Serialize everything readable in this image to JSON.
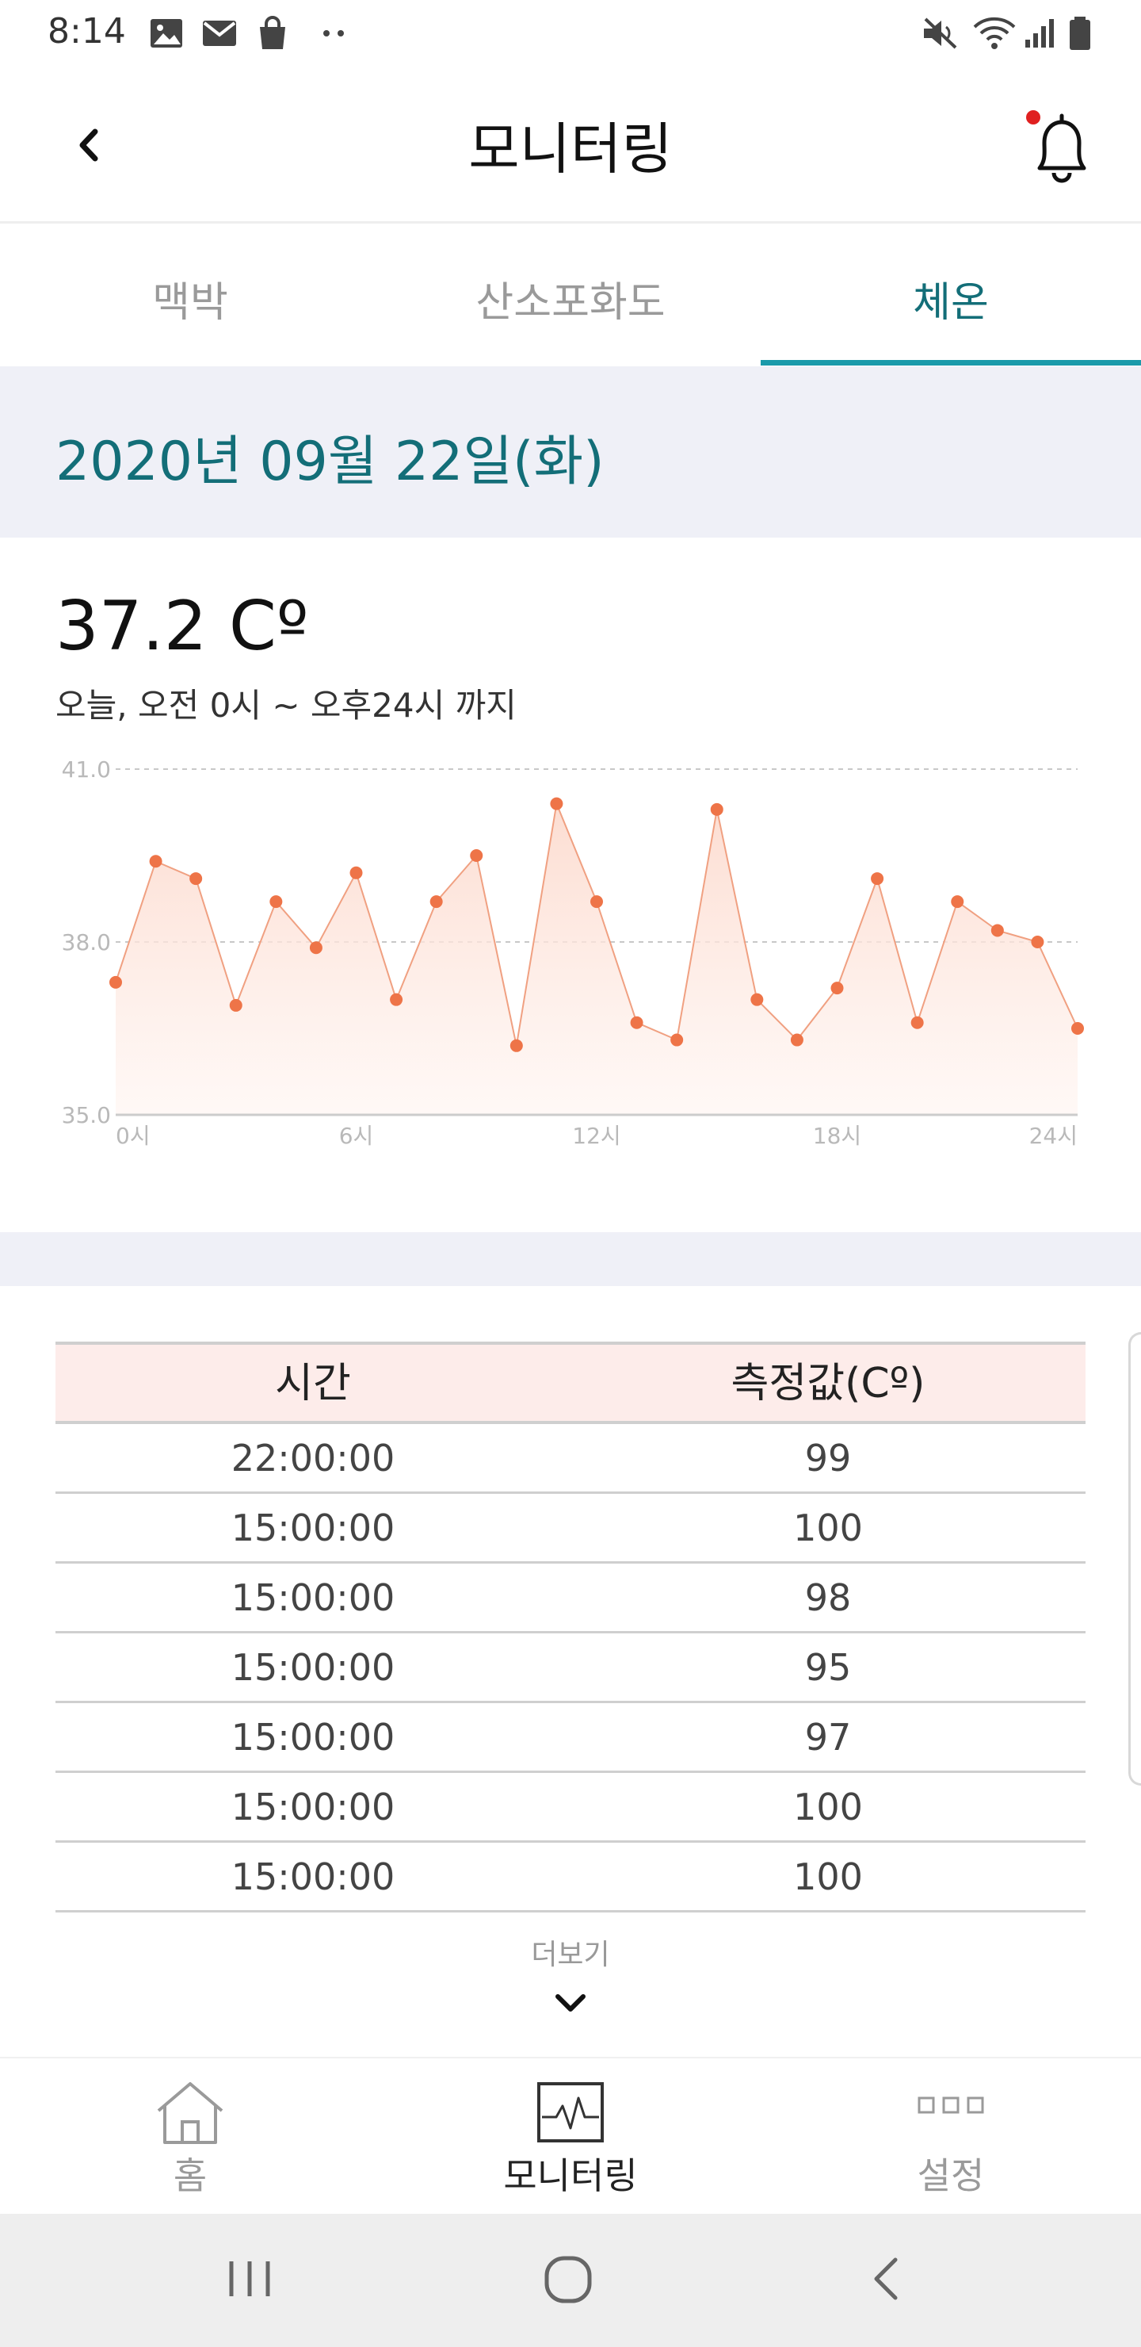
{
  "status_bar": {
    "time": "8:14",
    "left_icons": [
      "image-icon",
      "mail-icon",
      "shopping-bag-icon",
      "more-dots-icon"
    ],
    "right_icons": [
      "mute-icon",
      "wifi-icon",
      "signal-icon",
      "battery-icon"
    ]
  },
  "header": {
    "title": "모니터링",
    "back_icon": "chevron-left-icon",
    "bell_icon": "bell-icon",
    "notification_dot_color": "#e02020"
  },
  "tabs": [
    {
      "label": "맥박",
      "active": false
    },
    {
      "label": "산소포화도",
      "active": false
    },
    {
      "label": "체온",
      "active": true
    }
  ],
  "date_label": "2020년 09월 22일(화)",
  "summary": {
    "current_value": "37.2 Cº",
    "range_text": "오늘, 오전 0시 ~ 오후24시 까지"
  },
  "chart_data": {
    "type": "area",
    "x": [
      0,
      1,
      2,
      3,
      4,
      5,
      6,
      7,
      8,
      9,
      10,
      11,
      12,
      13,
      14,
      15,
      16,
      17,
      18,
      19,
      20,
      21,
      22,
      23,
      24
    ],
    "values": [
      37.3,
      39.4,
      39.1,
      36.9,
      38.7,
      37.9,
      39.2,
      37.0,
      38.7,
      39.5,
      36.2,
      40.4,
      38.7,
      36.6,
      36.3,
      40.3,
      37.0,
      36.3,
      37.2,
      39.1,
      36.6,
      38.7,
      38.2,
      38.0,
      36.5
    ],
    "xticks": [
      "0시",
      "6시",
      "12시",
      "18시",
      "24시"
    ],
    "xtick_values": [
      0,
      6,
      12,
      18,
      24
    ],
    "yticks": [
      "35.0",
      "38.0",
      "41.0"
    ],
    "ytick_values": [
      35.0,
      38.0,
      41.0
    ],
    "ylim": [
      35.0,
      41.0
    ],
    "xlim": [
      0,
      24
    ],
    "line_color": "#f0a081",
    "point_color": "#ee7448",
    "fill_color": "#fde6de",
    "grid": true
  },
  "table": {
    "headers": [
      "시간",
      "측정값(Cº)"
    ],
    "rows": [
      [
        "22:00:00",
        "99"
      ],
      [
        "15:00:00",
        "100"
      ],
      [
        "15:00:00",
        "98"
      ],
      [
        "15:00:00",
        "95"
      ],
      [
        "15:00:00",
        "97"
      ],
      [
        "15:00:00",
        "100"
      ],
      [
        "15:00:00",
        "100"
      ]
    ]
  },
  "more": {
    "label": "더보기",
    "icon": "chevron-down-icon"
  },
  "bottom_nav": [
    {
      "label": "홈",
      "icon": "home-icon",
      "active": false
    },
    {
      "label": "모니터링",
      "icon": "monitor-icon",
      "active": true
    },
    {
      "label": "설정",
      "icon": "settings-dots-icon",
      "active": false
    }
  ],
  "android_nav": [
    "recents-icon",
    "home-circle-icon",
    "back-icon"
  ]
}
